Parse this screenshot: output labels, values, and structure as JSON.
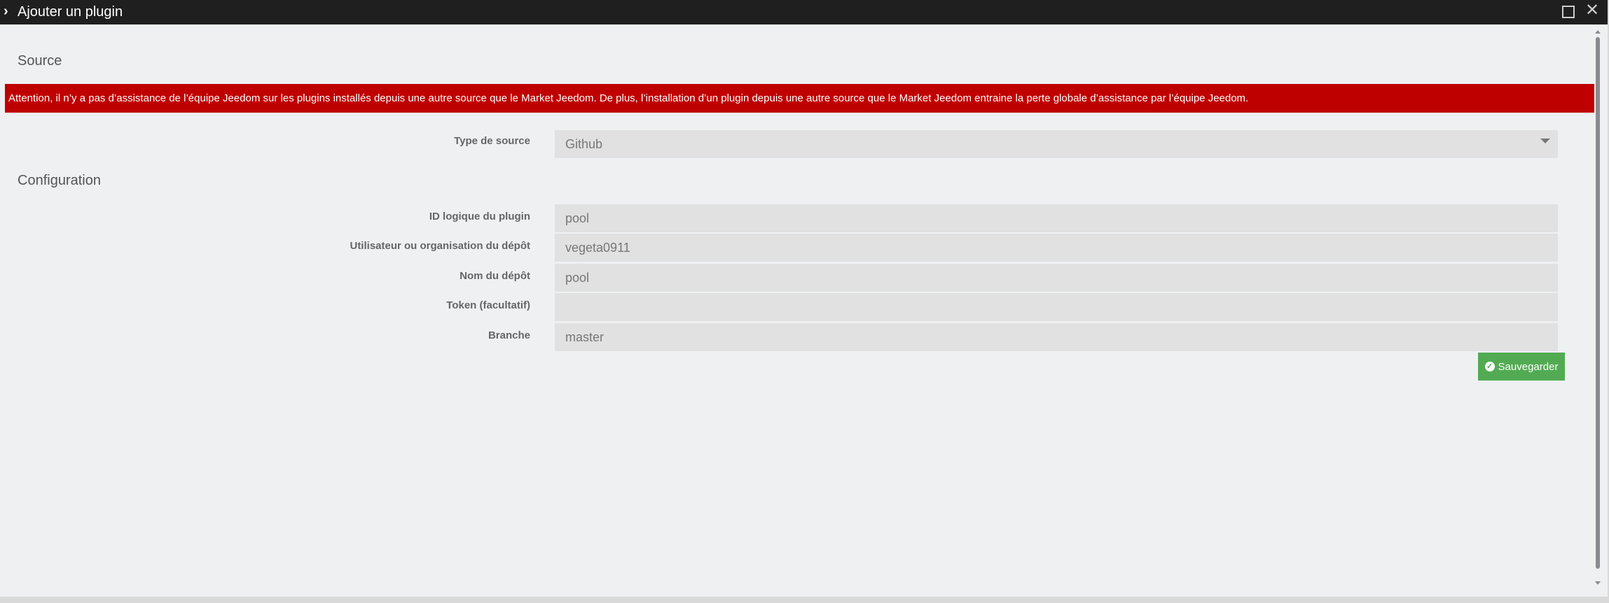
{
  "window": {
    "title": "Ajouter un plugin",
    "maximize_icon": "square-icon",
    "close_icon": "x-icon"
  },
  "source": {
    "heading": "Source",
    "alert": "Attention, il n’y a pas d’assistance de l’équipe Jeedom sur les plugins installés depuis une autre source que le Market Jeedom. De plus, l’installation d’un plugin depuis une autre source que le Market Jeedom entraine la perte globale d’assistance par l’équipe Jeedom.",
    "type_label": "Type de source",
    "type_value": "Github"
  },
  "configuration": {
    "heading": "Configuration",
    "fields": [
      {
        "label": "ID logique du plugin",
        "value": "pool"
      },
      {
        "label": "Utilisateur ou organisation du dépôt",
        "value": "vegeta0911"
      },
      {
        "label": "Nom du dépôt",
        "value": "pool"
      },
      {
        "label": "Token (facultatif)",
        "value": ""
      },
      {
        "label": "Branche",
        "value": "master"
      }
    ]
  },
  "save_button": {
    "label": "Sauvegarder",
    "icon": "check-circle-icon"
  },
  "colors": {
    "alert": "#bf0000",
    "save": "#52ab53",
    "titlebar": "#1f1f1f"
  }
}
